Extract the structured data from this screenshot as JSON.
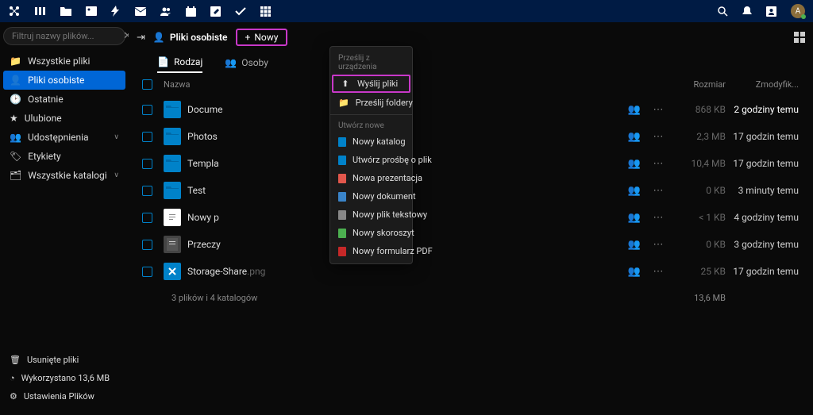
{
  "search": {
    "placeholder": "Filtruj nazwy plików..."
  },
  "sidebar": {
    "items": [
      {
        "label": "Wszystkie pliki"
      },
      {
        "label": "Pliki osobiste"
      },
      {
        "label": "Ostatnie"
      },
      {
        "label": "Ulubione"
      },
      {
        "label": "Udostępnienia"
      },
      {
        "label": "Etykiety"
      },
      {
        "label": "Wszystkie katalogi"
      }
    ],
    "bottom": [
      {
        "label": "Usunięte pliki"
      },
      {
        "label": "Wykorzystano 13,6 MB"
      },
      {
        "label": "Ustawienia Plików"
      }
    ]
  },
  "breadcrumb": {
    "title": "Pliki osobiste"
  },
  "newButton": {
    "label": "Nowy"
  },
  "tabs": [
    {
      "label": "Rodzaj"
    },
    {
      "label": "Osoby"
    }
  ],
  "columns": {
    "name": "Nazwa",
    "size": "Rozmiar",
    "modified": "Zmodyfik..."
  },
  "rows": [
    {
      "name": "Docume",
      "ext": "",
      "type": "folder",
      "size": "868 KB",
      "modified": "2 godziny temu"
    },
    {
      "name": "Photos",
      "ext": "",
      "type": "folder",
      "size": "2,3 MB",
      "modified": "17 godzin temu"
    },
    {
      "name": "Templa",
      "ext": "",
      "type": "folder",
      "size": "10,4 MB",
      "modified": "17 godzin temu"
    },
    {
      "name": "Test",
      "ext": "",
      "type": "folder",
      "size": "0 KB",
      "modified": "3 minuty temu"
    },
    {
      "name": "Nowy p",
      "ext": "",
      "type": "doc",
      "size": "< 1 KB",
      "modified": "4 godziny temu"
    },
    {
      "name": "Przeczy",
      "ext": "",
      "type": "doc2",
      "size": "0 KB",
      "modified": "3 godziny temu"
    },
    {
      "name": "Storage-Share",
      "ext": ".png",
      "type": "img",
      "size": "25 KB",
      "modified": "17 godzin temu"
    }
  ],
  "footer": {
    "summary": "3 plików i 4 katalogów",
    "totalSize": "13,6 MB"
  },
  "dropdown": {
    "section1": "Prześlij z urządzenia",
    "items1": [
      {
        "label": "Wyślij pliki"
      },
      {
        "label": "Prześlij foldery"
      }
    ],
    "section2": "Utwórz nowe",
    "items2": [
      {
        "label": "Nowy katalog",
        "color": "#0082c9"
      },
      {
        "label": "Utwórz prośbę o plik",
        "color": "#0082c9"
      },
      {
        "label": "Nowa prezentacja",
        "color": "#e2574c"
      },
      {
        "label": "Nowy dokument",
        "color": "#3a84c9"
      },
      {
        "label": "Nowy plik tekstowy",
        "color": "#888"
      },
      {
        "label": "Nowy skoroszyt",
        "color": "#4caf50"
      },
      {
        "label": "Nowy formularz PDF",
        "color": "#c62828"
      }
    ]
  },
  "avatar": "A"
}
